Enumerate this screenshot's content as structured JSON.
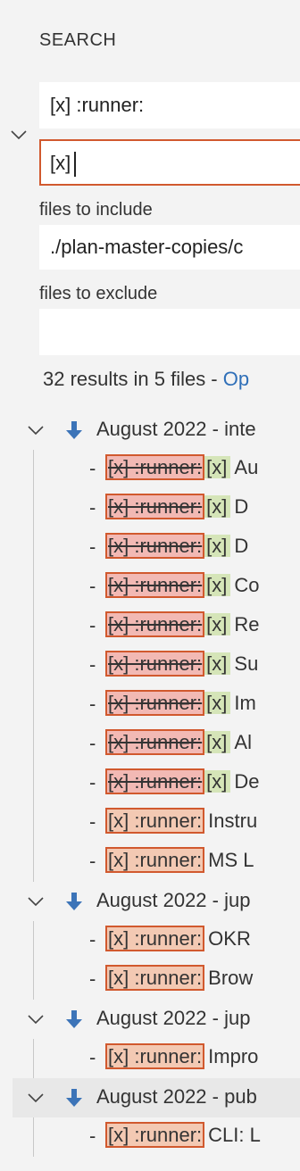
{
  "panel": {
    "title": "SEARCH"
  },
  "search": {
    "value": "[x] :runner:"
  },
  "replace": {
    "value": "[x]"
  },
  "include": {
    "label": "files to include",
    "value": "./plan-master-copies/c"
  },
  "exclude": {
    "label": "files to exclude",
    "value": ""
  },
  "results": {
    "summary": "32 results in 5 files - ",
    "link": "Op"
  },
  "colors": {
    "accent_border": "#d1592e",
    "match_bg": "#f3c9b3",
    "removed_bg": "#f2b9b4",
    "inserted_bg": "#d5e5b8",
    "link": "#2f6fb8",
    "file_icon": "#3c74b8"
  },
  "files": [
    {
      "name": "August 2022 - inte",
      "matches": [
        {
          "dash": "-",
          "find": "[x] :runner:",
          "replace": "[x]",
          "rest": "Au"
        },
        {
          "dash": "-",
          "find": "[x] :runner:",
          "replace": "[x]",
          "rest": "D"
        },
        {
          "dash": "-",
          "find": "[x] :runner:",
          "replace": "[x]",
          "rest": "D"
        },
        {
          "dash": "-",
          "find": "[x] :runner:",
          "replace": "[x]",
          "rest": "Co"
        },
        {
          "dash": "-",
          "find": "[x] :runner:",
          "replace": "[x]",
          "rest": "Re"
        },
        {
          "dash": "-",
          "find": "[x] :runner:",
          "replace": "[x]",
          "rest": "Su"
        },
        {
          "dash": "-",
          "find": "[x] :runner:",
          "replace": "[x]",
          "rest": "Im"
        },
        {
          "dash": "-",
          "find": "[x] :runner:",
          "replace": "[x]",
          "rest": "Al"
        },
        {
          "dash": "-",
          "find": "[x] :runner:",
          "replace": "[x]",
          "rest": "De"
        },
        {
          "dash": "-",
          "find": "[x] :runner:",
          "rest": "Instru"
        },
        {
          "dash": "-",
          "find": "[x] :runner:",
          "rest": "MS L"
        }
      ]
    },
    {
      "name": "August 2022 - jup",
      "matches": [
        {
          "dash": "-",
          "find": "[x] :runner:",
          "rest": "OKR"
        },
        {
          "dash": "-",
          "find": "[x] :runner:",
          "rest": "Brow"
        }
      ]
    },
    {
      "name": "August 2022 - jup",
      "matches": [
        {
          "dash": "-",
          "find": "[x] :runner:",
          "rest": "Impro"
        }
      ]
    },
    {
      "name": "August 2022 - pub",
      "matches": [
        {
          "dash": "-",
          "find": "[x] :runner:",
          "rest": "CLI: L"
        }
      ]
    }
  ]
}
